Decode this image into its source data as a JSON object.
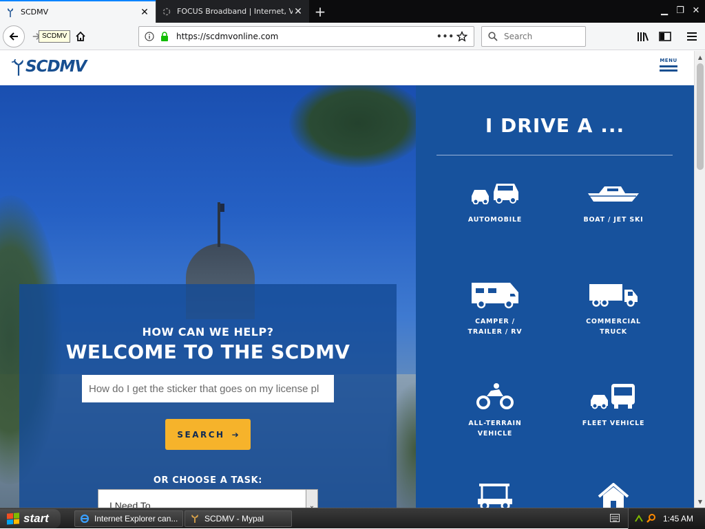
{
  "browser": {
    "tabs": [
      {
        "title": "SCDMV",
        "active": true
      },
      {
        "title": "FOCUS Broadband | Internet, Vide",
        "active": false
      }
    ],
    "tooltip": "SCDMV",
    "url": "https://scdmvonline.com",
    "search_placeholder": "Search",
    "accent_color": "#0a84ff"
  },
  "site": {
    "logo_text": "SCDMV",
    "menu_label": "MENU",
    "brand_color": "#184f90"
  },
  "hero": {
    "kicker": "HOW CAN WE HELP?",
    "headline": "WELCOME TO THE SCDMV",
    "search_placeholder": "How do I get the sticker that goes on my license pl",
    "search_button": "SEARCH",
    "choose_label": "OR CHOOSE A TASK:",
    "task_select_value": "I Need To ...",
    "button_color": "#f6b32b"
  },
  "drive": {
    "title": "I DRIVE A ...",
    "panel_color": "#17529d",
    "vehicles": [
      {
        "label": "AUTOMOBILE",
        "icon": "cars-icon"
      },
      {
        "label": "BOAT / JET SKI",
        "icon": "boat-icon"
      },
      {
        "label": "CAMPER / TRAILER / RV",
        "label_line1": "CAMPER /",
        "label_line2": "TRAILER / RV",
        "icon": "camper-icon"
      },
      {
        "label": "COMMERCIAL TRUCK",
        "label_line1": "COMMERCIAL",
        "label_line2": "TRUCK",
        "icon": "truck-icon"
      },
      {
        "label": "ALL-TERRAIN VEHICLE",
        "label_line1": "ALL-TERRAIN",
        "label_line2": "VEHICLE",
        "icon": "atv-icon"
      },
      {
        "label": "FLEET VEHICLE",
        "icon": "fleet-icon"
      },
      {
        "label": "",
        "icon": "golf-cart-icon"
      },
      {
        "label": "",
        "icon": "house-icon"
      }
    ]
  },
  "taskbar": {
    "start_label": "start",
    "items": [
      {
        "label": "Internet Explorer can...",
        "icon": "ie-icon"
      },
      {
        "label": "SCDMV - Mypal",
        "icon": "mypal-icon"
      }
    ],
    "clock": "1:45 AM"
  }
}
